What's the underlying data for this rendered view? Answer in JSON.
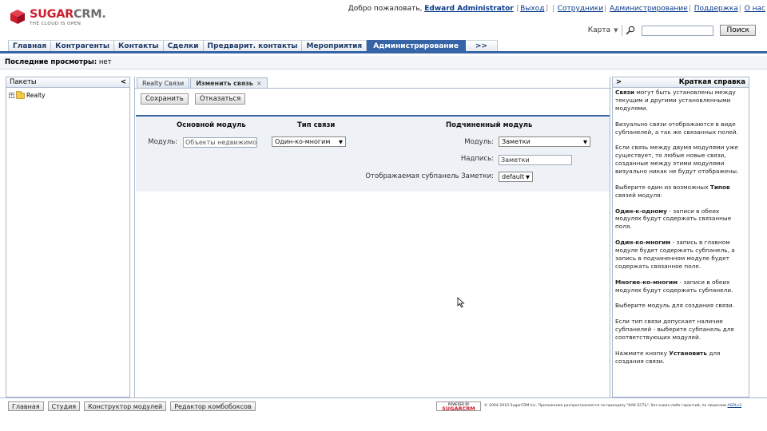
{
  "brand": {
    "name_part1": "SUGAR",
    "name_part2": "CRM.",
    "tagline": "THE CLOUD IS OPEN",
    "colors": {
      "red": "#cc1e2e",
      "grey": "#6d6e71",
      "accent": "#3764a6"
    }
  },
  "header": {
    "welcome": "Добро пожаловать,",
    "user": "Edward Administrator",
    "logout": "Выход",
    "links": [
      "Сотрудники",
      "Администрирование",
      "Поддержка",
      "О нас"
    ],
    "map_label": "Карта",
    "search_button": "Поиск",
    "search_value": ""
  },
  "tabs": [
    {
      "label": "Главная",
      "active": false
    },
    {
      "label": "Контрагенты",
      "active": false
    },
    {
      "label": "Контакты",
      "active": false
    },
    {
      "label": "Сделки",
      "active": false
    },
    {
      "label": "Предварит. контакты",
      "active": false
    },
    {
      "label": "Мероприятия",
      "active": false
    },
    {
      "label": "Администрирование",
      "active": true
    },
    {
      "label": ">>",
      "active": false
    }
  ],
  "recent": {
    "label": "Последние просмотры:",
    "value": "нет"
  },
  "left_panel": {
    "title": "Пакеты",
    "collapse": "<",
    "tree": [
      {
        "label": "Realty",
        "expander": "+"
      }
    ]
  },
  "subtabs": [
    {
      "label": "Realty Связи",
      "active": false
    },
    {
      "label": "Изменить связь",
      "active": true,
      "close": "×"
    }
  ],
  "actions": {
    "save": "Сохранить",
    "cancel": "Отказаться"
  },
  "relationship": {
    "primary_header": "Основной модуль",
    "type_header": "Тип связи",
    "related_header": "Подчиненный модуль",
    "primary_label": "Модуль:",
    "primary_value": "Объекты недвижимост",
    "type_value": "Один-ко-многим",
    "related_label": "Модуль:",
    "related_value": "Заметки",
    "caption_label": "Надпись:",
    "caption_value": "Заметки",
    "subpanel_label": "Отображаемая субпанель Заметки:",
    "subpanel_value": "default"
  },
  "help": {
    "title": "Краткая справка",
    "toggle": ">",
    "p1_bold": "Связи",
    "p1": " могут быть установлены между текущим и другими установленными модулями.",
    "p2": "Визуально связи отображаются в виде субпанелей, а так же связанных полей.",
    "p3": "Если связь между двумя модулями уже существует, то любые новые связи, созданные между этими модулями визуально никак не будут отображены.",
    "p4_pre": "Выберите один из возможных ",
    "p4_bold": "Типов",
    "p4_post": " связей модуля:",
    "p5_bold": "Один-к-одному",
    "p5": " - записи в обеих модулях будут содержать связанные поля.",
    "p6_bold": "Один-ко-многим",
    "p6": " - запись в главном модуле будет содержать субпанель, а запись в подчиненном модуле будет содержать связанное поле.",
    "p7_bold": "Многие-ко-многим",
    "p7": " - записи в обеих модулях будут содержать субпанели.",
    "p8": "Выберите модуль для создания связи.",
    "p9": "Если тип связи допускает наличие субпанелей - выберите субпанель для соответствующих модулей.",
    "p10_pre": "Нажмите кнопку ",
    "p10_bold": "Установить",
    "p10_post": " для создания связи."
  },
  "footer": {
    "buttons": [
      "Главная",
      "Студия",
      "Конструктор модулей",
      "Редактор комбобоксов"
    ],
    "powered_top": "POWERED BY",
    "powered_logo": "SUGARCRM",
    "copyright": "© 2004-2010 SugarCRM Inc. Приложение распространяется по принципу \"КАК ЕСТЬ\", без каких-либо гарантий, по лицензии",
    "license": "AGPLv3"
  }
}
